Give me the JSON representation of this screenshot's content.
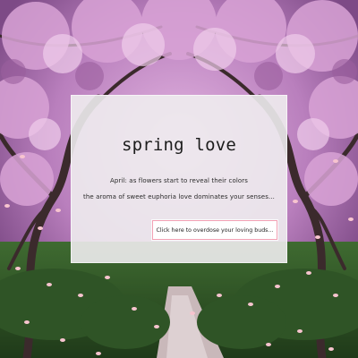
{
  "card": {
    "title": "spring love",
    "line1": "April: as flowers start to reveal their colors",
    "line2": "the aroma of sweet euphoria love dominates your senses...",
    "cta_label": "Click here to overdose your loving buds..."
  },
  "colors": {
    "accent": "#f2a1b4",
    "card_background": "#eeecee",
    "blossom": "#c88ac4"
  }
}
